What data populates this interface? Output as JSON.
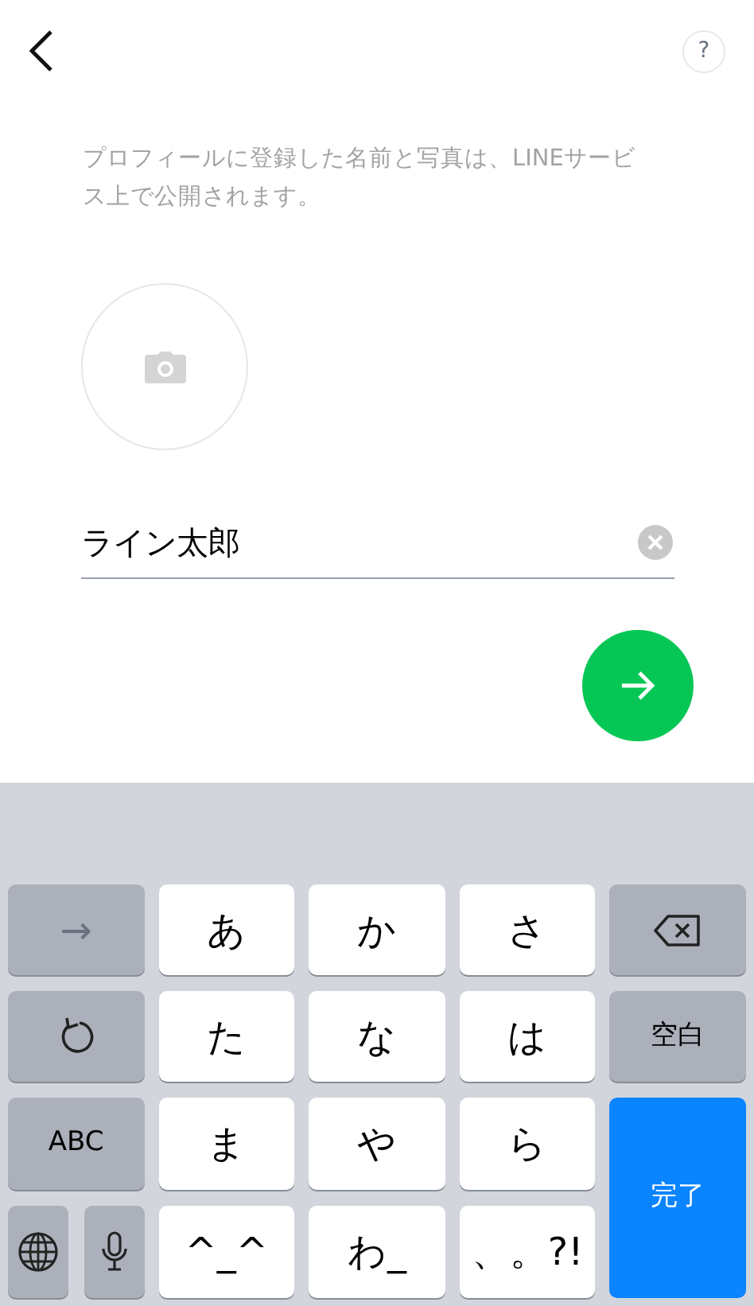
{
  "help_label": "?",
  "description": "プロフィールに登録した名前と写真は、LINEサービス上で公開されます。",
  "name_field": {
    "value": "ライン太郎"
  },
  "keyboard": [
    {
      "kind": "function",
      "label": "→"
    },
    {
      "kind": "letter",
      "label": "あ"
    },
    {
      "kind": "letter",
      "label": "か"
    },
    {
      "kind": "letter",
      "label": "さ"
    },
    {
      "kind": "delete"
    },
    {
      "kind": "undo"
    },
    {
      "kind": "letter",
      "label": "た"
    },
    {
      "kind": "letter",
      "label": "な"
    },
    {
      "kind": "letter",
      "label": "は"
    },
    {
      "kind": "function",
      "label": "空白"
    },
    {
      "kind": "function",
      "label": "ABC"
    },
    {
      "kind": "letter",
      "label": "ま"
    },
    {
      "kind": "letter",
      "label": "や"
    },
    {
      "kind": "letter",
      "label": "ら"
    },
    {
      "kind": "done",
      "label": "完了"
    },
    {
      "kind": "globe"
    },
    {
      "kind": "mic"
    },
    {
      "kind": "letter",
      "label": "^_^"
    },
    {
      "kind": "letter",
      "label": "わ_"
    },
    {
      "kind": "letter",
      "label": "、。?!"
    }
  ]
}
